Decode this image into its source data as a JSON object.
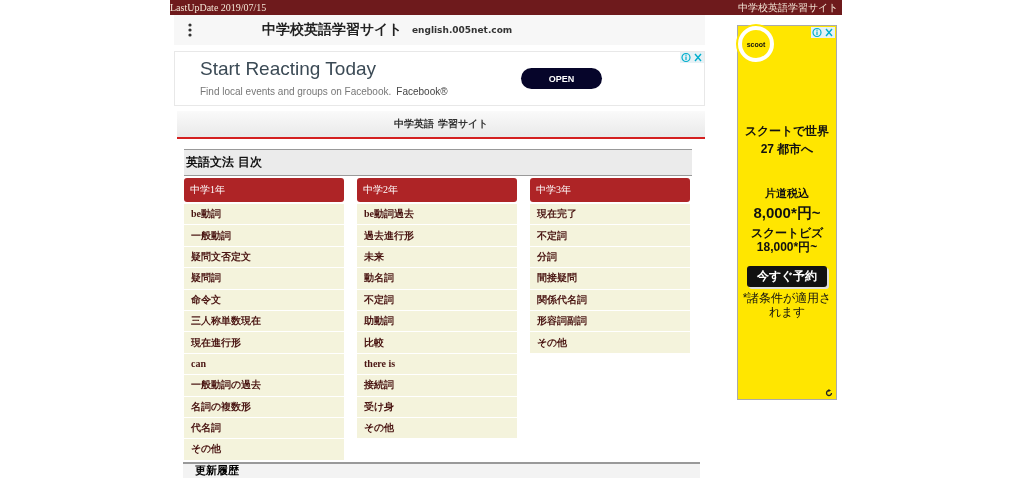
{
  "top_bar": {
    "last_update": "LastUpDate 2019/07/15",
    "site_name": "中学校英語学習サイト"
  },
  "header": {
    "title": "中学校英語学習サイト",
    "domain": "english.005net.com"
  },
  "banner_ad": {
    "headline": "Start Reacting Today",
    "description": "Find local events and groups on Facebook.",
    "advertiser": "Facebook®",
    "button": "OPEN"
  },
  "nav_bar": {
    "title": "中学英語 学習サイト"
  },
  "section": {
    "title": "英語文法 目次",
    "columns": [
      {
        "heading": "中学1年",
        "items": [
          "be動詞",
          "一般動詞",
          "疑問文否定文",
          "疑問詞",
          "命令文",
          "三人称単数現在",
          "現在進行形",
          "can",
          "一般動詞の過去",
          "名詞の複数形",
          "代名詞",
          "その他"
        ]
      },
      {
        "heading": "中学2年",
        "items": [
          "be動詞過去",
          "過去進行形",
          "未来",
          "動名詞",
          "不定詞",
          "助動詞",
          "比較",
          "there is",
          "接続詞",
          "受け身",
          "その他"
        ]
      },
      {
        "heading": "中学3年",
        "items": [
          "現在完了",
          "不定詞",
          "分詞",
          "間接疑問",
          "関係代名詞",
          "形容詞副詞",
          "その他"
        ]
      }
    ]
  },
  "next_section": {
    "title": "更新履歴"
  },
  "side_ad": {
    "logo": "scoot",
    "headline_1": "スクートで世界",
    "headline_2": "27 都市へ",
    "price_label": "片道税込",
    "price": "8,000*円~",
    "sub_price": "スクートビズ 18,000*円~",
    "button": "今すぐ予約",
    "note": "*諸条件が適用されます"
  }
}
